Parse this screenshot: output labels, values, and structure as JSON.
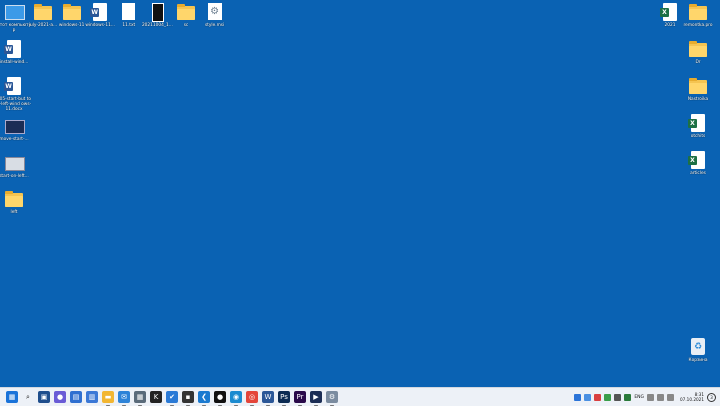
{
  "desktop": {
    "left_icons": [
      {
        "label": "Этот компьютер",
        "type": "pc"
      },
      {
        "label": "install-wind...",
        "type": "word"
      },
      {
        "label": "005-start-but ton-left-wind ows-11.docx",
        "type": "word"
      },
      {
        "label": "move-start-...",
        "type": "thumb"
      },
      {
        "label": "start-on-left...",
        "type": "thumb2"
      },
      {
        "label": "left",
        "type": "folder"
      }
    ],
    "top_icons": [
      {
        "label": "july-2021-a...",
        "type": "folder"
      },
      {
        "label": "windows-11",
        "type": "folder"
      },
      {
        "label": "windows-11...",
        "type": "word"
      },
      {
        "label": "11.txt",
        "type": "txt"
      },
      {
        "label": "20211004_1...",
        "type": "vid"
      },
      {
        "label": "sc",
        "type": "folder"
      },
      {
        "label": "style.msi",
        "type": "gear"
      }
    ],
    "right_icons": [
      {
        "label": "2021",
        "type": "excel"
      },
      {
        "label": "remontka.pro",
        "type": "folder"
      },
      {
        "label": "Dr",
        "type": "folder"
      },
      {
        "label": "Nastroika",
        "type": "folder"
      },
      {
        "label": "otchits",
        "type": "excel"
      },
      {
        "label": "articles",
        "type": "excel"
      },
      {
        "label": "Корзина",
        "type": "bin"
      }
    ]
  },
  "taskbar": {
    "apps": [
      {
        "name": "start",
        "color": "#1a73d9",
        "glyph": "▦"
      },
      {
        "name": "search",
        "color": "#edf1f7",
        "glyph": "⌕"
      },
      {
        "name": "task-view",
        "color": "#1f4e8c",
        "glyph": "▣"
      },
      {
        "name": "chat",
        "color": "#6a5bd6",
        "glyph": "●"
      },
      {
        "name": "widgets",
        "color": "#2f6fd0",
        "glyph": "▤"
      },
      {
        "name": "store",
        "color": "#3b78d6",
        "glyph": "▥"
      },
      {
        "name": "explorer",
        "color": "#f2b632",
        "glyph": "▬"
      },
      {
        "name": "mail",
        "color": "#2d83d8",
        "glyph": "✉"
      },
      {
        "name": "calculator",
        "color": "#5a6b7a",
        "glyph": "▦"
      },
      {
        "name": "app-black",
        "color": "#222",
        "glyph": "K"
      },
      {
        "name": "todo",
        "color": "#2a7ad6",
        "glyph": "✔"
      },
      {
        "name": "terminal",
        "color": "#333",
        "glyph": "▪"
      },
      {
        "name": "vscode",
        "color": "#1b7ad0",
        "glyph": "❮"
      },
      {
        "name": "github",
        "color": "#111",
        "glyph": "●"
      },
      {
        "name": "edge",
        "color": "#1b8bd0",
        "glyph": "◉"
      },
      {
        "name": "chrome",
        "color": "#e4453a",
        "glyph": "◎"
      },
      {
        "name": "word",
        "color": "#2b5797",
        "glyph": "W"
      },
      {
        "name": "photoshop",
        "color": "#0b2a52",
        "glyph": "Ps"
      },
      {
        "name": "premiere",
        "color": "#2a0a4a",
        "glyph": "Pr"
      },
      {
        "name": "media-app",
        "color": "#1b2d55",
        "glyph": "▶"
      },
      {
        "name": "settings",
        "color": "#7b8ca0",
        "glyph": "⚙"
      }
    ],
    "tray": {
      "language": "ENG",
      "time": "8:31",
      "date": "07.10.2021",
      "notifications": "3"
    }
  }
}
